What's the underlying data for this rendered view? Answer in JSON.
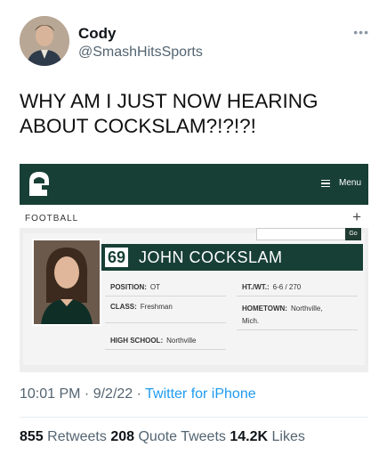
{
  "tweet": {
    "display_name": "Cody",
    "handle": "@SmashHitsSports",
    "more_icon": "more-icon",
    "text_line1": "WHY AM I JUST NOW HEARING",
    "text_line2": "ABOUT COCKSLAM?!?!?!",
    "timestamp": "10:01 PM · 9/2/22 · ",
    "source": "Twitter for iPhone",
    "retweets_count": "855",
    "retweets_label": "Retweets",
    "quotes_count": "208",
    "quotes_label": "Quote Tweets",
    "likes_count": "14.2K",
    "likes_label": "Likes"
  },
  "embed": {
    "menu_label": "Menu",
    "sport_label": "FOOTBALL",
    "plus_symbol": "+",
    "go_label": "Go",
    "player": {
      "number": "69",
      "name": "JOHN COCKSLAM",
      "position_label": "POSITION:",
      "position": "OT",
      "htwt_label": "HT./WT.:",
      "htwt": "6-6 / 270",
      "class_label": "CLASS:",
      "class": "Freshman",
      "hometown_label": "HOMETOWN:",
      "hometown_line1": "Northville,",
      "hometown_line2": "Mich.",
      "highschool_label": "HIGH SCHOOL:",
      "highschool": "Northville"
    }
  },
  "colors": {
    "msu_green": "#173f35",
    "link_blue": "#1d9bf0",
    "muted": "#536471"
  }
}
